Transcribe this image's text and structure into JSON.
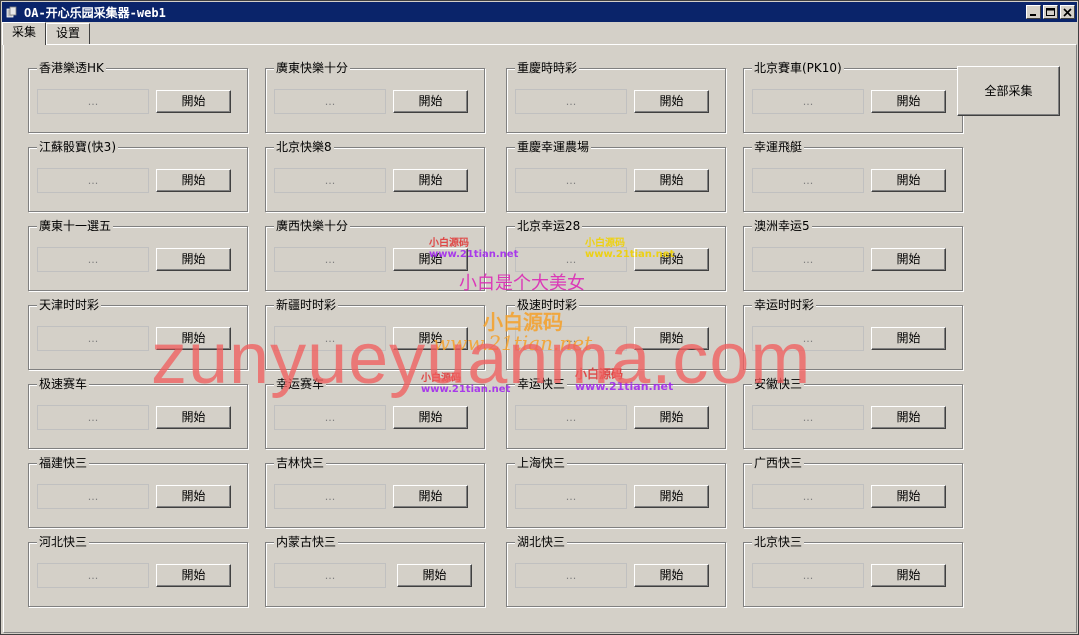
{
  "window": {
    "title": "OA-开心乐园采集器-web1",
    "controls": [
      "minimize-icon",
      "maximize-icon",
      "close-icon"
    ]
  },
  "tabs": [
    {
      "label": "采集",
      "active": true
    },
    {
      "label": "设置",
      "active": false
    }
  ],
  "collector": {
    "status_placeholder": "...",
    "start_label": "開始",
    "collect_all_label": "全部采集",
    "groups": [
      {
        "title": "香港樂透HK"
      },
      {
        "title": "廣東快樂十分"
      },
      {
        "title": "重慶時時彩"
      },
      {
        "title": "北京賽車(PK10)"
      },
      {
        "title": "江蘇骰寶(快3)"
      },
      {
        "title": "北京快樂8"
      },
      {
        "title": "重慶幸運農場"
      },
      {
        "title": "幸運飛艇"
      },
      {
        "title": "廣東十一選五"
      },
      {
        "title": "廣西快樂十分"
      },
      {
        "title": "北京幸运28"
      },
      {
        "title": "澳洲幸运5"
      },
      {
        "title": "天津时时彩"
      },
      {
        "title": "新疆时时彩"
      },
      {
        "title": "极速时时彩"
      },
      {
        "title": "幸运时时彩"
      },
      {
        "title": "极速赛车"
      },
      {
        "title": "幸运赛车"
      },
      {
        "title": "幸运快三"
      },
      {
        "title": "安徽快三"
      },
      {
        "title": "福建快三"
      },
      {
        "title": "吉林快三"
      },
      {
        "title": "上海快三"
      },
      {
        "title": "广西快三"
      },
      {
        "title": "河北快三"
      },
      {
        "title": "内蒙古快三"
      },
      {
        "title": "湖北快三"
      },
      {
        "title": "北京快三"
      }
    ]
  },
  "watermarks": {
    "main": "zunyueyuanma.com",
    "slogan": "小白是个大美女",
    "brand": "小白源码",
    "url": "www.21tian.net",
    "small_brand": "小白源码",
    "small_brand_alt": "小白源码",
    "small_url": "www.21tian.net"
  },
  "colors": {
    "titlebar": "#0a246a",
    "face": "#d4d0c8",
    "watermark_main": "#f05f5f",
    "watermark_pink": "#dc1eb4",
    "watermark_orange": "#f5a028",
    "watermark_yellow": "#f0d000",
    "watermark_red_small": "#e03030",
    "watermark_purple_small": "#a020f0"
  }
}
